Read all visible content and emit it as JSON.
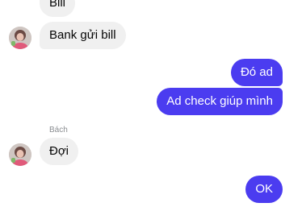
{
  "conversation": {
    "messages": [
      {
        "text": "Bill",
        "direction": "incoming"
      },
      {
        "text": "Bank gửi bill",
        "direction": "incoming"
      },
      {
        "text": "Đó ad",
        "direction": "outgoing"
      },
      {
        "text": "Ad check giúp mình",
        "direction": "outgoing"
      },
      {
        "text": "Đợi",
        "direction": "incoming"
      },
      {
        "text": "OK",
        "direction": "outgoing"
      }
    ],
    "sender_label": "Bách"
  },
  "colors": {
    "incoming_bubble": "#f0f0f0",
    "outgoing_bubble": "#4b3cf0",
    "sender_label": "#8a8d91"
  }
}
